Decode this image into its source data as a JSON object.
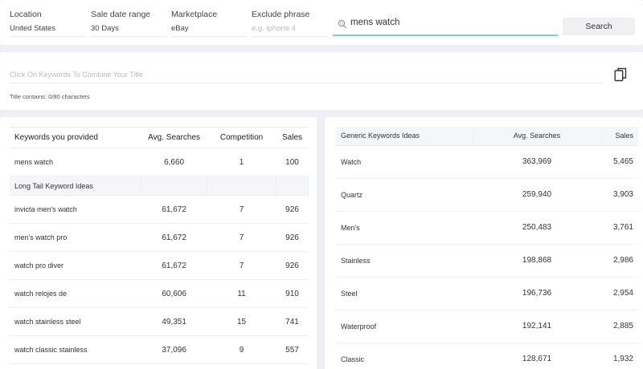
{
  "filters": {
    "location": {
      "label": "Location",
      "value": "United States"
    },
    "sale_date_range": {
      "label": "Sale date range",
      "value": "30 Days"
    },
    "marketplace": {
      "label": "Marketplace",
      "value": "eBay"
    },
    "exclude_phrase": {
      "label": "Exclude phrase",
      "placeholder": "e.g. iphone 4"
    },
    "search": {
      "value": "mens watch",
      "button_label": "Search",
      "icon": "search-icon"
    }
  },
  "title_builder": {
    "placeholder": "Click On Keywords To Combine Your Title",
    "count_text": "Title contains: 0/80 characters",
    "copy_icon": "copy-icon"
  },
  "keywords_table": {
    "headers": [
      "Keywords you provided",
      "Avg. Searches",
      "Competition",
      "Sales"
    ],
    "provided": [
      {
        "keyword": "mens watch",
        "avg": "6,660",
        "competition": "1",
        "sales": "100"
      }
    ],
    "section_label": "Long Tail Keyword Ideas",
    "long_tail": [
      {
        "keyword": "invicta men's watch",
        "avg": "61,672",
        "competition": "7",
        "sales": "926"
      },
      {
        "keyword": "men's watch pro",
        "avg": "61,672",
        "competition": "7",
        "sales": "926"
      },
      {
        "keyword": "watch pro diver",
        "avg": "61,672",
        "competition": "7",
        "sales": "926"
      },
      {
        "keyword": "watch relojes de",
        "avg": "60,606",
        "competition": "11",
        "sales": "910"
      },
      {
        "keyword": "watch stainless steel",
        "avg": "49,351",
        "competition": "15",
        "sales": "741"
      },
      {
        "keyword": "watch classic stainless",
        "avg": "37,096",
        "competition": "9",
        "sales": "557"
      }
    ]
  },
  "generic_table": {
    "headers": [
      "Generic Keywords Ideas",
      "Avg. Searches",
      "Sales"
    ],
    "rows": [
      {
        "keyword": "Watch",
        "avg": "363,969",
        "sales": "5,465"
      },
      {
        "keyword": "Quartz",
        "avg": "259,940",
        "sales": "3,903"
      },
      {
        "keyword": "Men's",
        "avg": "250,483",
        "sales": "3,761"
      },
      {
        "keyword": "Stainless",
        "avg": "198,868",
        "sales": "2,986"
      },
      {
        "keyword": "Steel",
        "avg": "196,736",
        "sales": "2,954"
      },
      {
        "keyword": "Waterproof",
        "avg": "192,141",
        "sales": "2,885"
      },
      {
        "keyword": "Classic",
        "avg": "128,671",
        "sales": "1,932"
      }
    ]
  },
  "colors": {
    "accent": "#7fd3c9",
    "background": "#eef0f5",
    "section_bg": "#f5f6f9"
  }
}
